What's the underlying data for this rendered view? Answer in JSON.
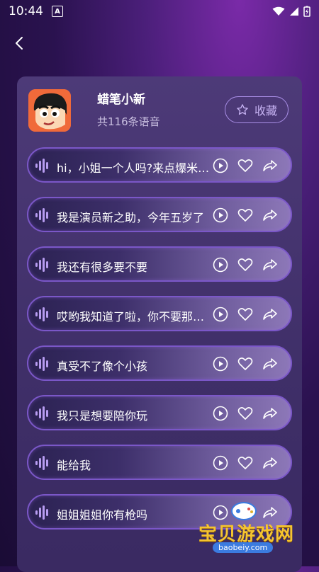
{
  "status": {
    "time": "10:44",
    "notif": "A"
  },
  "header": {
    "back_label": ""
  },
  "pack": {
    "name": "蜡笔小新",
    "count_text": "共116条语音",
    "fav_label": "收藏"
  },
  "items": [
    {
      "text": "hi，小姐一个人吗?来点爆米花吧"
    },
    {
      "text": "我是演员新之助，今年五岁了"
    },
    {
      "text": "我还有很多要不要"
    },
    {
      "text": "哎哟我知道了啦，你不要那么凶嘛"
    },
    {
      "text": "真受不了像个小孩"
    },
    {
      "text": "我只是想要陪你玩"
    },
    {
      "text": "能给我"
    },
    {
      "text": "姐姐姐姐你有枪吗"
    }
  ],
  "watermark": {
    "text": "宝贝游戏网",
    "url": "baobeiy.com"
  },
  "colors": {
    "accent": "#a98ee6",
    "card": "#4d3a78",
    "item_border": "#7b57c8",
    "wave": "#b79cf0"
  }
}
